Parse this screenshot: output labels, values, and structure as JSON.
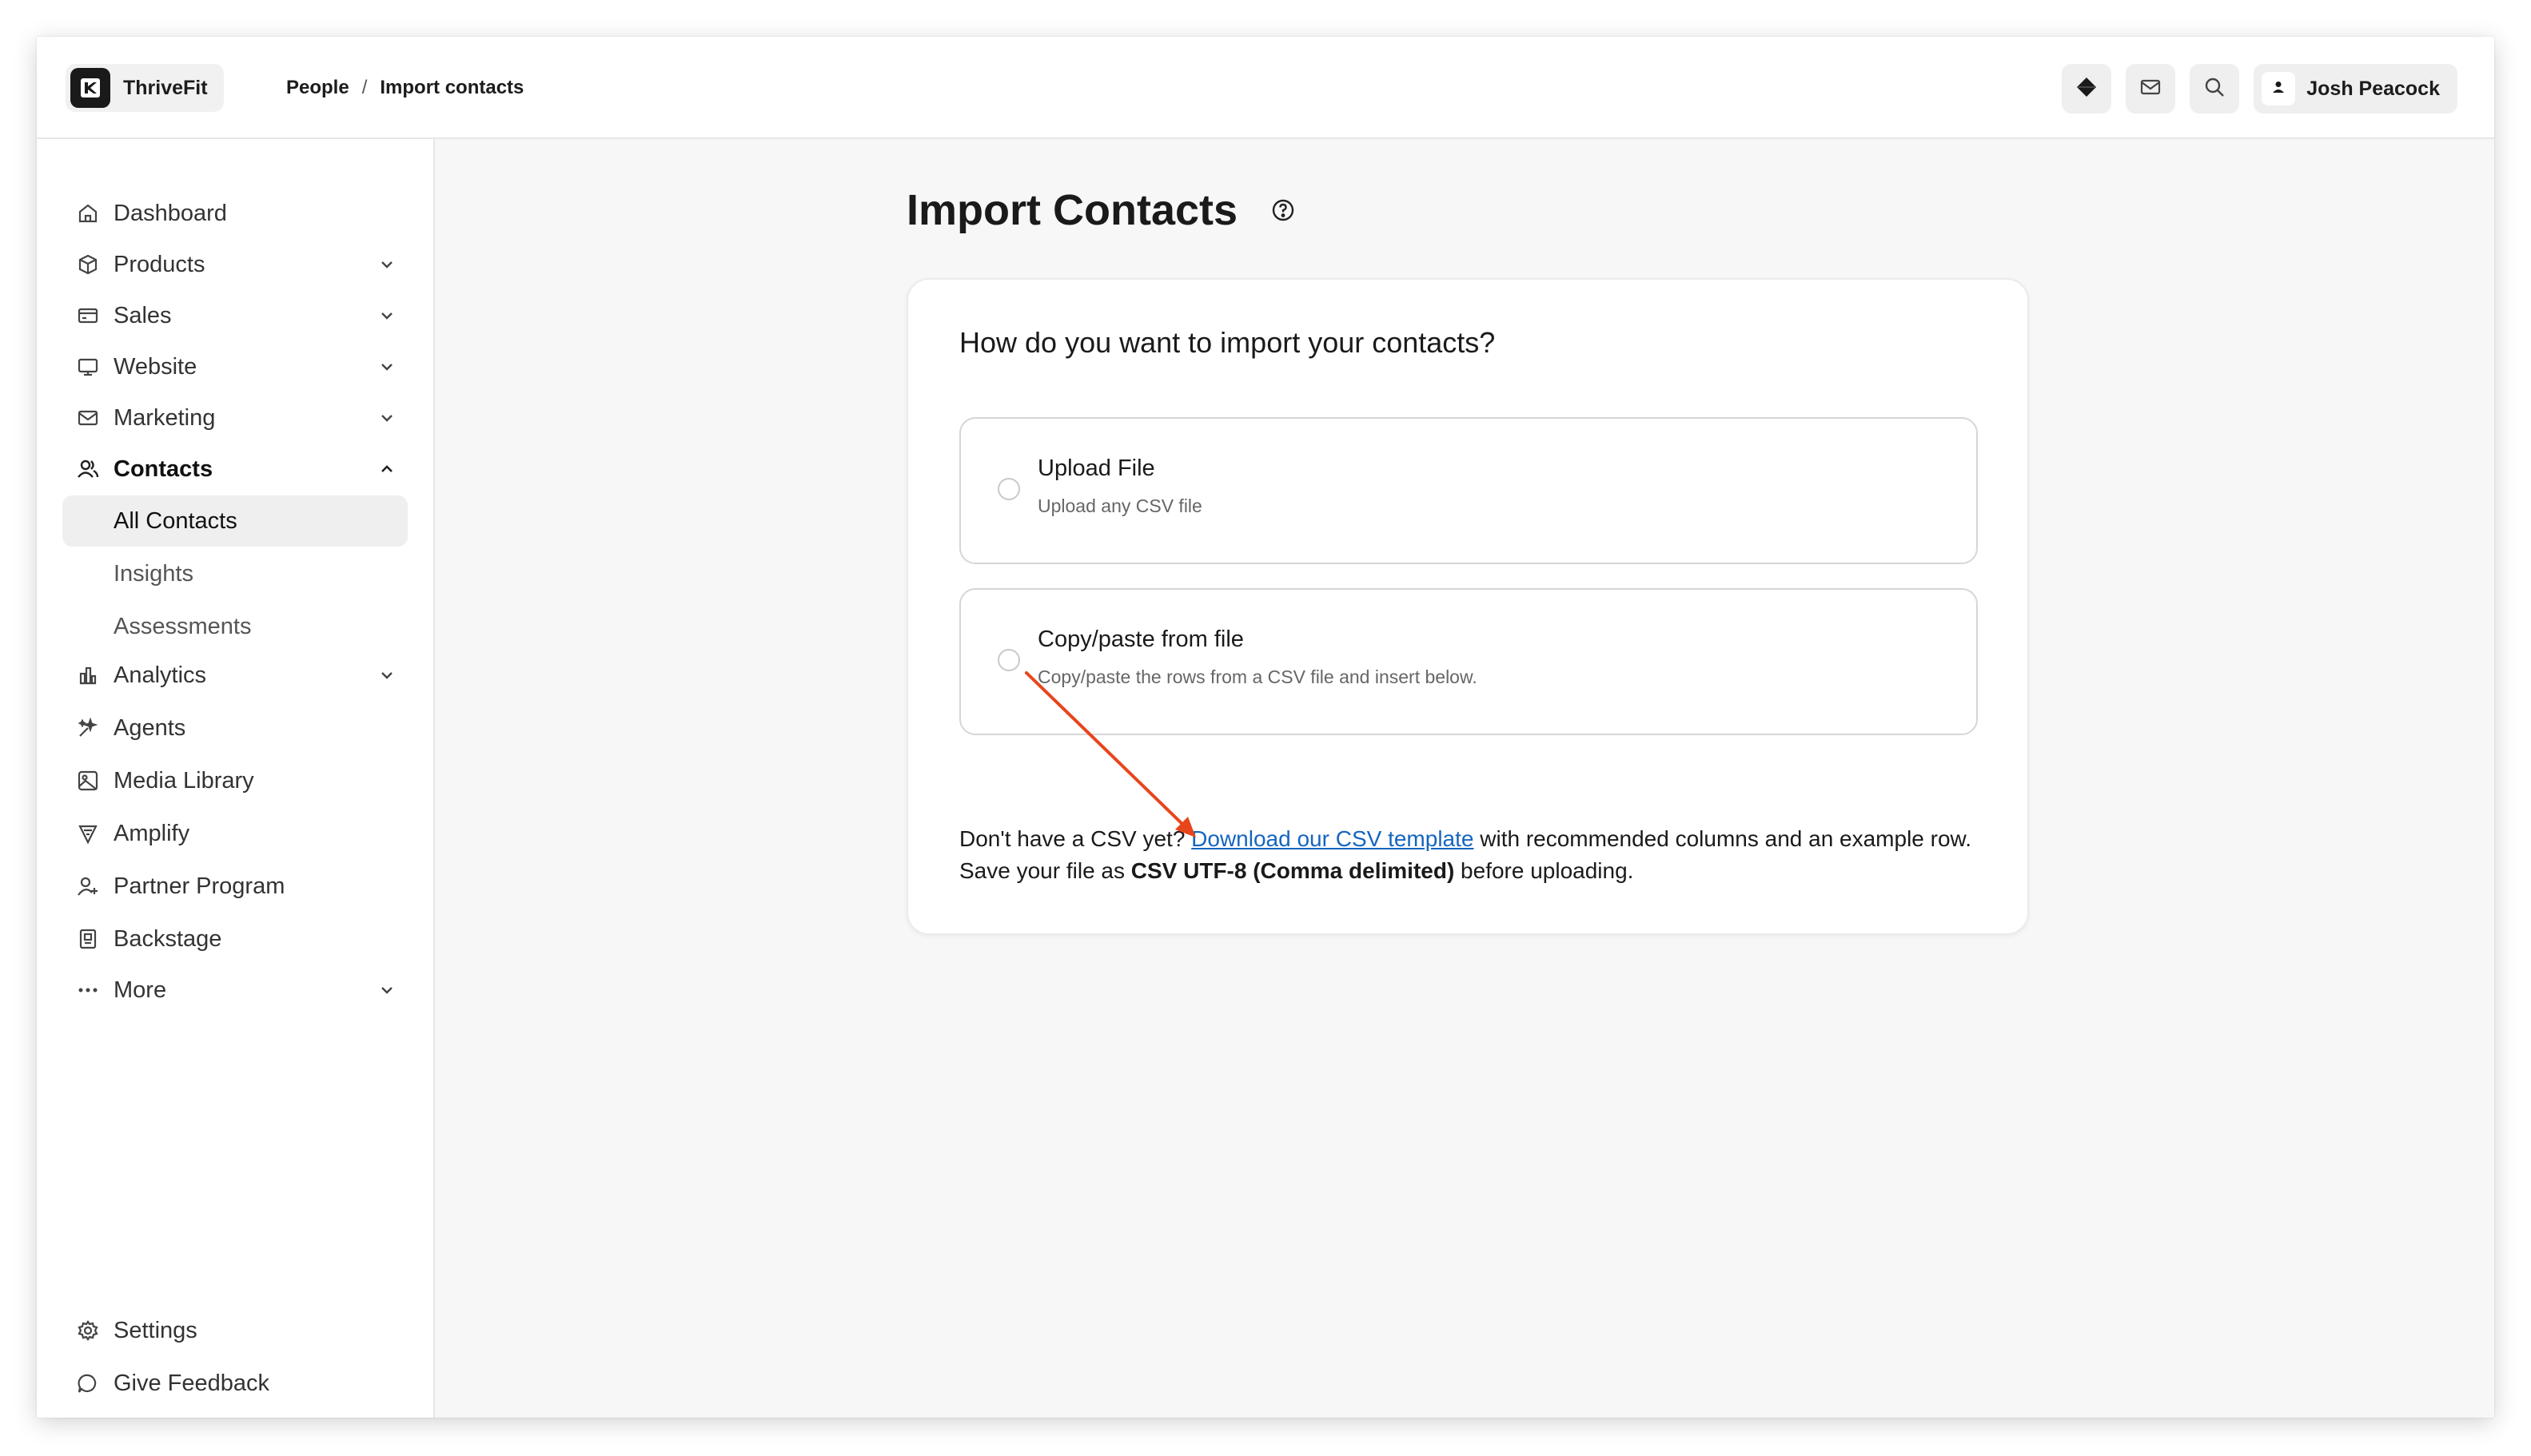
{
  "app": {
    "name": "ThriveFit"
  },
  "breadcrumb": {
    "parent": "People",
    "separator": "/",
    "current": "Import contacts"
  },
  "topbar": {
    "icons": [
      "diamond-icon",
      "mail-icon",
      "search-icon"
    ],
    "user_name": "Josh Peacock"
  },
  "sidebar": {
    "items": [
      {
        "label": "Dashboard",
        "icon": "home-icon"
      },
      {
        "label": "Products",
        "icon": "box-icon"
      },
      {
        "label": "Sales",
        "icon": "card-icon"
      },
      {
        "label": "Website",
        "icon": "monitor-icon"
      },
      {
        "label": "Marketing",
        "icon": "mail-icon"
      },
      {
        "label": "Contacts",
        "icon": "users-icon"
      },
      {
        "label": "Analytics",
        "icon": "bar-chart-icon"
      },
      {
        "label": "Agents",
        "icon": "sparkle-icon"
      },
      {
        "label": "Media Library",
        "icon": "image-icon"
      },
      {
        "label": "Amplify",
        "icon": "megaphone-icon"
      },
      {
        "label": "Partner Program",
        "icon": "user-plus-icon"
      },
      {
        "label": "Backstage",
        "icon": "badge-icon"
      },
      {
        "label": "More",
        "icon": "ellipsis-icon"
      }
    ],
    "contacts_sub": [
      {
        "label": "All Contacts",
        "selected": true
      },
      {
        "label": "Insights"
      },
      {
        "label": "Assessments"
      }
    ],
    "footer": [
      {
        "label": "Settings",
        "icon": "gear-icon"
      },
      {
        "label": "Give Feedback",
        "icon": "chat-bubble-icon"
      }
    ]
  },
  "main": {
    "title": "Import Contacts",
    "question": "How do you want to import your contacts?",
    "options": [
      {
        "title": "Upload File",
        "description": "Upload any CSV file"
      },
      {
        "title": "Copy/paste from file",
        "description": "Copy/paste the rows from a CSV file and insert below."
      }
    ],
    "help": {
      "prefix": "Don't have a CSV yet? ",
      "link": "Download our CSV template",
      "middle": " with recommended columns and an example row. Save your file as ",
      "format": "CSV UTF-8 (Comma delimited)",
      "suffix": " before uploading."
    }
  },
  "colors": {
    "accent_link": "#1565c0",
    "annotation_arrow": "#e8451c"
  }
}
